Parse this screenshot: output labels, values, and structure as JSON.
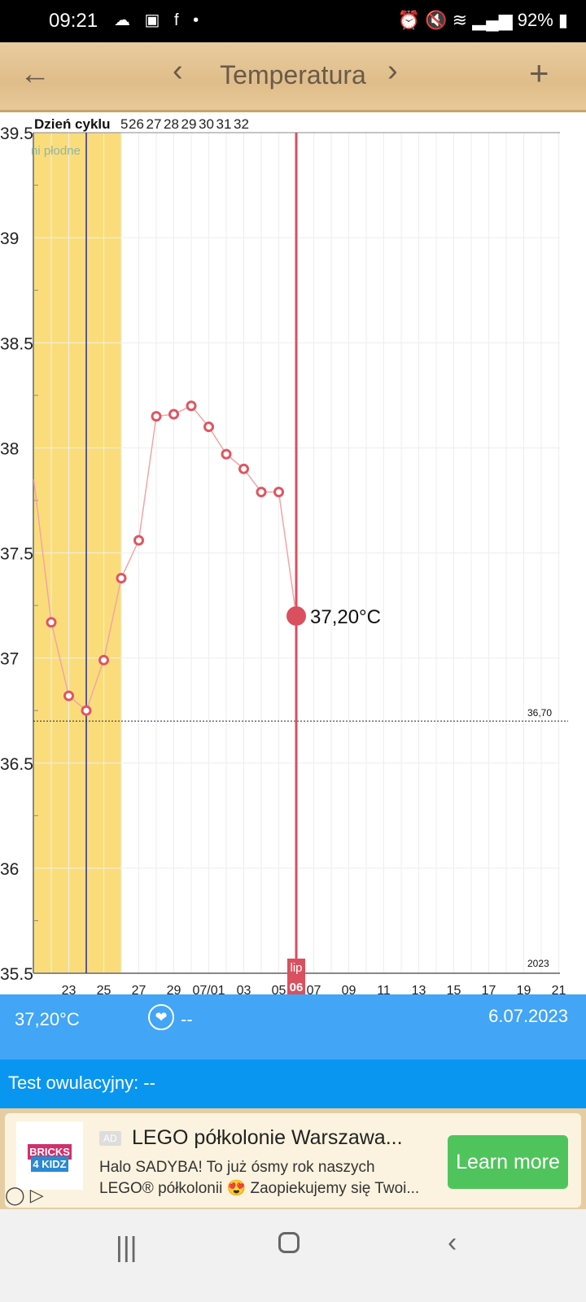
{
  "status_bar": {
    "time": "09:21",
    "battery": "92%"
  },
  "header": {
    "title": "Temperatura",
    "back": "←",
    "prev": "‹",
    "next": "›",
    "add": "+"
  },
  "chart_data": {
    "type": "line",
    "ylim": [
      35.5,
      39.5
    ],
    "y_ticks": [
      "39.5",
      "39",
      "38.5",
      "38",
      "37.5",
      "37",
      "36.5",
      "36",
      "35.5"
    ],
    "x_tick_labels": [
      "23",
      "25",
      "27",
      "29",
      "07/01",
      "03",
      "05",
      "07",
      "09",
      "11",
      "13",
      "15",
      "17",
      "19",
      "21"
    ],
    "cycle_day_label": "Dzień cyklu",
    "cycle_days": [
      "5",
      "26",
      "27",
      "28",
      "29",
      "30",
      "31",
      "32"
    ],
    "fertile_label": "ni płodne",
    "coverline": 36.7,
    "coverline_label": "36,70",
    "year_label": "2023",
    "selected": {
      "month": "lip",
      "day": "06",
      "value_label": "37,20°C",
      "value": 37.2
    },
    "x": [
      "06-21",
      "06-22",
      "06-23",
      "06-24",
      "06-25",
      "06-26",
      "06-27",
      "06-28",
      "06-29",
      "06-30",
      "07-01",
      "07-02",
      "07-03",
      "07-04",
      "07-05",
      "07-06"
    ],
    "values": [
      37.85,
      37.17,
      36.82,
      36.75,
      36.99,
      37.38,
      37.56,
      38.15,
      38.16,
      38.2,
      38.1,
      37.97,
      37.9,
      37.79,
      37.79,
      37.2
    ],
    "colors": {
      "line": "#f2a5a5",
      "marker": "#e05561",
      "fertile": "#fadd7a",
      "ovulation_line": "#2a2a9a",
      "selected": "#d9505e"
    }
  },
  "info": {
    "temperature": "37,20°C",
    "intercourse": "--",
    "date": "6.07.2023",
    "ovulation_test": "Test owulacyjny: --"
  },
  "ad": {
    "badge": "AD",
    "title": "LEGO półkolonie Warszawa...",
    "line1": "Halo SADYBA! To już ósmy rok naszych",
    "line2": "LEGO® półkolonii 😍 Zaopiekujemy się Twoi...",
    "cta": "Learn more",
    "logo_text": "BRICKS 4 KIDZ"
  }
}
